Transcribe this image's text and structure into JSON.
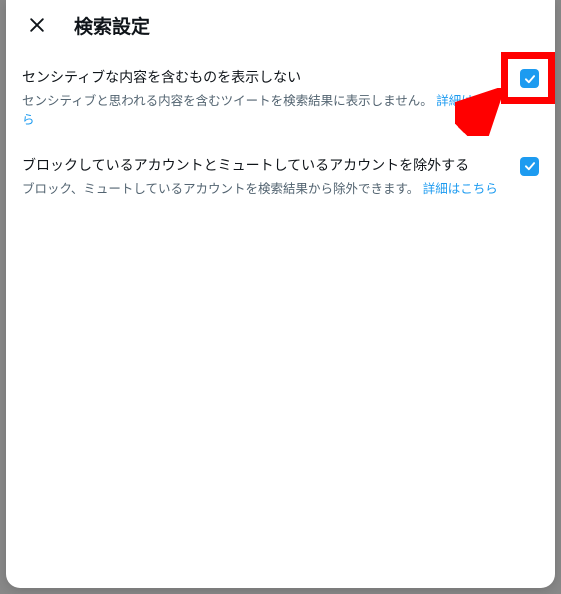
{
  "header": {
    "title": "検索設定"
  },
  "settings": [
    {
      "label": "センシティブな内容を含むものを表示しない",
      "description": "センシティブと思われる内容を含むツイートを検索結果に表示しません。",
      "learn_more": "詳細はこちら",
      "checked": true
    },
    {
      "label": "ブロックしているアカウントとミュートしているアカウントを除外する",
      "description": "ブロック、ミュートしているアカウントを検索結果から除外できます。",
      "learn_more": "詳細はこちら",
      "checked": true
    }
  ]
}
